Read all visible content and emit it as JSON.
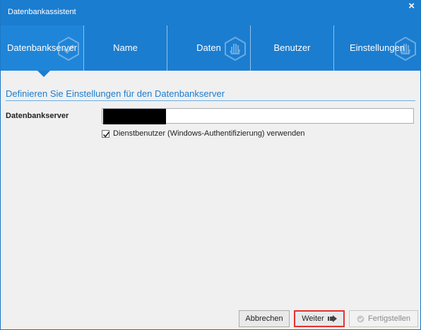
{
  "window": {
    "title": "Datenbankassistent",
    "close_glyph": "×"
  },
  "steps": [
    {
      "label": "Datenbankserver",
      "active": true,
      "icon": "checkmark-icon"
    },
    {
      "label": "Name",
      "active": false,
      "icon": ""
    },
    {
      "label": "Daten",
      "active": false,
      "icon": "hand-icon"
    },
    {
      "label": "Benutzer",
      "active": false,
      "icon": ""
    },
    {
      "label": "Einstellungen",
      "active": false,
      "icon": "hand-icon"
    }
  ],
  "section": {
    "title": "Definieren Sie Einstellungen für den Datenbankserver"
  },
  "form": {
    "server_label": "Datenbankserver",
    "server_value": "",
    "use_service_user_label": "Dienstbenutzer (Windows-Authentifizierung) verwenden",
    "use_service_user_checked": true
  },
  "buttons": {
    "cancel": "Abbrechen",
    "next": "Weiter",
    "finish": "Fertigstellen"
  },
  "colors": {
    "accent": "#1b7dd0",
    "highlight_border": "#e33333"
  }
}
